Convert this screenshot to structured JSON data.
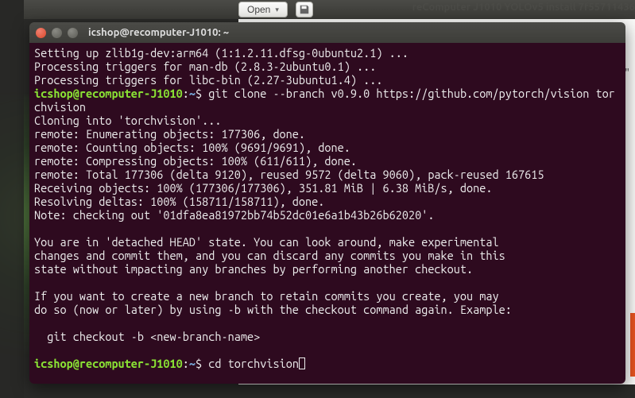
{
  "background": {
    "editor_tab_title": "reComputer J1010 YOLOv5 install 7f55711436",
    "open_button": "Open",
    "stray_text_right": "0 0\""
  },
  "terminal": {
    "title": "icshop@recomputer-J1010: ~",
    "prompt_user_host": "icshop@recomputer-J1010",
    "prompt_sep": ":",
    "prompt_path": "~",
    "prompt_dollar": "$",
    "lines": {
      "l1": "Setting up zlib1g-dev:arm64 (1:1.2.11.dfsg-0ubuntu2.1) ...",
      "l2": "Processing triggers for man-db (2.8.3-2ubuntu0.1) ...",
      "l3": "Processing triggers for libc-bin (2.27-3ubuntu1.4) ...",
      "cmd1": " git clone --branch v0.9.0 https://github.com/pytorch/vision torchvision",
      "l5": "Cloning into 'torchvision'...",
      "l6": "remote: Enumerating objects: 177306, done.",
      "l7": "remote: Counting objects: 100% (9691/9691), done.",
      "l8": "remote: Compressing objects: 100% (611/611), done.",
      "l9": "remote: Total 177306 (delta 9120), reused 9572 (delta 9060), pack-reused 167615",
      "l10": "Receiving objects: 100% (177306/177306), 351.81 MiB | 6.38 MiB/s, done.",
      "l11": "Resolving deltas: 100% (158711/158711), done.",
      "l12": "Note: checking out '01dfa8ea81972bb74b52dc01e6a1b43b26b62020'.",
      "l13": "",
      "l14": "You are in 'detached HEAD' state. You can look around, make experimental",
      "l15": "changes and commit them, and you can discard any commits you make in this",
      "l16": "state without impacting any branches by performing another checkout.",
      "l17": "",
      "l18": "If you want to create a new branch to retain commits you create, you may",
      "l19": "do so (now or later) by using -b with the checkout command again. Example:",
      "l20": "",
      "l21": "  git checkout -b <new-branch-name>",
      "l22": "",
      "cmd2": " cd torchvision"
    }
  }
}
